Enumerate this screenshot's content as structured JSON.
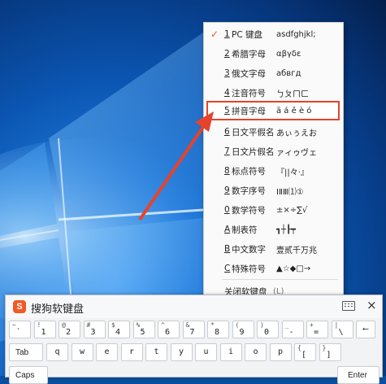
{
  "menu": {
    "items": [
      {
        "num": "1",
        "label": "PC 键盘",
        "sample": "asdfghjkl;",
        "checked": true
      },
      {
        "num": "2",
        "label": "希腊字母",
        "sample": "αβγδε"
      },
      {
        "num": "3",
        "label": "俄文字母",
        "sample": "абвгд"
      },
      {
        "num": "4",
        "label": "注音符号",
        "sample": "ㄅㄆㄇㄈ"
      },
      {
        "num": "5",
        "label": "拼音字母",
        "sample": "ā á ě è ó",
        "highlighted": true
      },
      {
        "num": "6",
        "label": "日文平假名",
        "sample": "あぃぅえお"
      },
      {
        "num": "7",
        "label": "日文片假名",
        "sample": "ァィゥヴェ"
      },
      {
        "num": "8",
        "label": "标点符号",
        "sample": "『||々·』"
      },
      {
        "num": "9",
        "label": "数字序号",
        "sample": "ⅠⅡⅢ⑴①"
      },
      {
        "num": "0",
        "label": "数学符号",
        "sample": "±×÷∑√"
      },
      {
        "num": "A",
        "label": "制表符",
        "sample": "┓┼┠┯"
      },
      {
        "num": "B",
        "label": "中文数字",
        "sample": "壹贰千万兆"
      },
      {
        "num": "C",
        "label": "特殊符号",
        "sample": "▲☆◆□→"
      }
    ],
    "close_label": "关闭软键盘",
    "close_shortcut": "(L)",
    "check_mark": "✓"
  },
  "keyboard": {
    "title": "搜狗软键盘",
    "logo": "S",
    "close": "×",
    "row1": [
      {
        "top": "~",
        "bot": "`"
      },
      {
        "top": "!",
        "bot": "1"
      },
      {
        "top": "@",
        "bot": "2"
      },
      {
        "top": "#",
        "bot": "3"
      },
      {
        "top": "$",
        "bot": "4"
      },
      {
        "top": "%",
        "bot": "5"
      },
      {
        "top": "^",
        "bot": "6"
      },
      {
        "top": "&",
        "bot": "7"
      },
      {
        "top": "*",
        "bot": "8"
      },
      {
        "top": "(",
        "bot": "9"
      },
      {
        "top": ")",
        "bot": "0"
      },
      {
        "top": "_",
        "bot": "-"
      },
      {
        "top": "+",
        "bot": "="
      },
      {
        "top": "|",
        "bot": "\\"
      }
    ],
    "backspace": "⟵",
    "tab": "Tab",
    "row2": [
      "q",
      "w",
      "e",
      "r",
      "t",
      "y",
      "u",
      "i",
      "o",
      "p"
    ],
    "row2_extra": [
      {
        "top": "{",
        "bot": "["
      },
      {
        "top": "}",
        "bot": "]"
      }
    ],
    "caps": "Caps",
    "enter": "Enter"
  }
}
